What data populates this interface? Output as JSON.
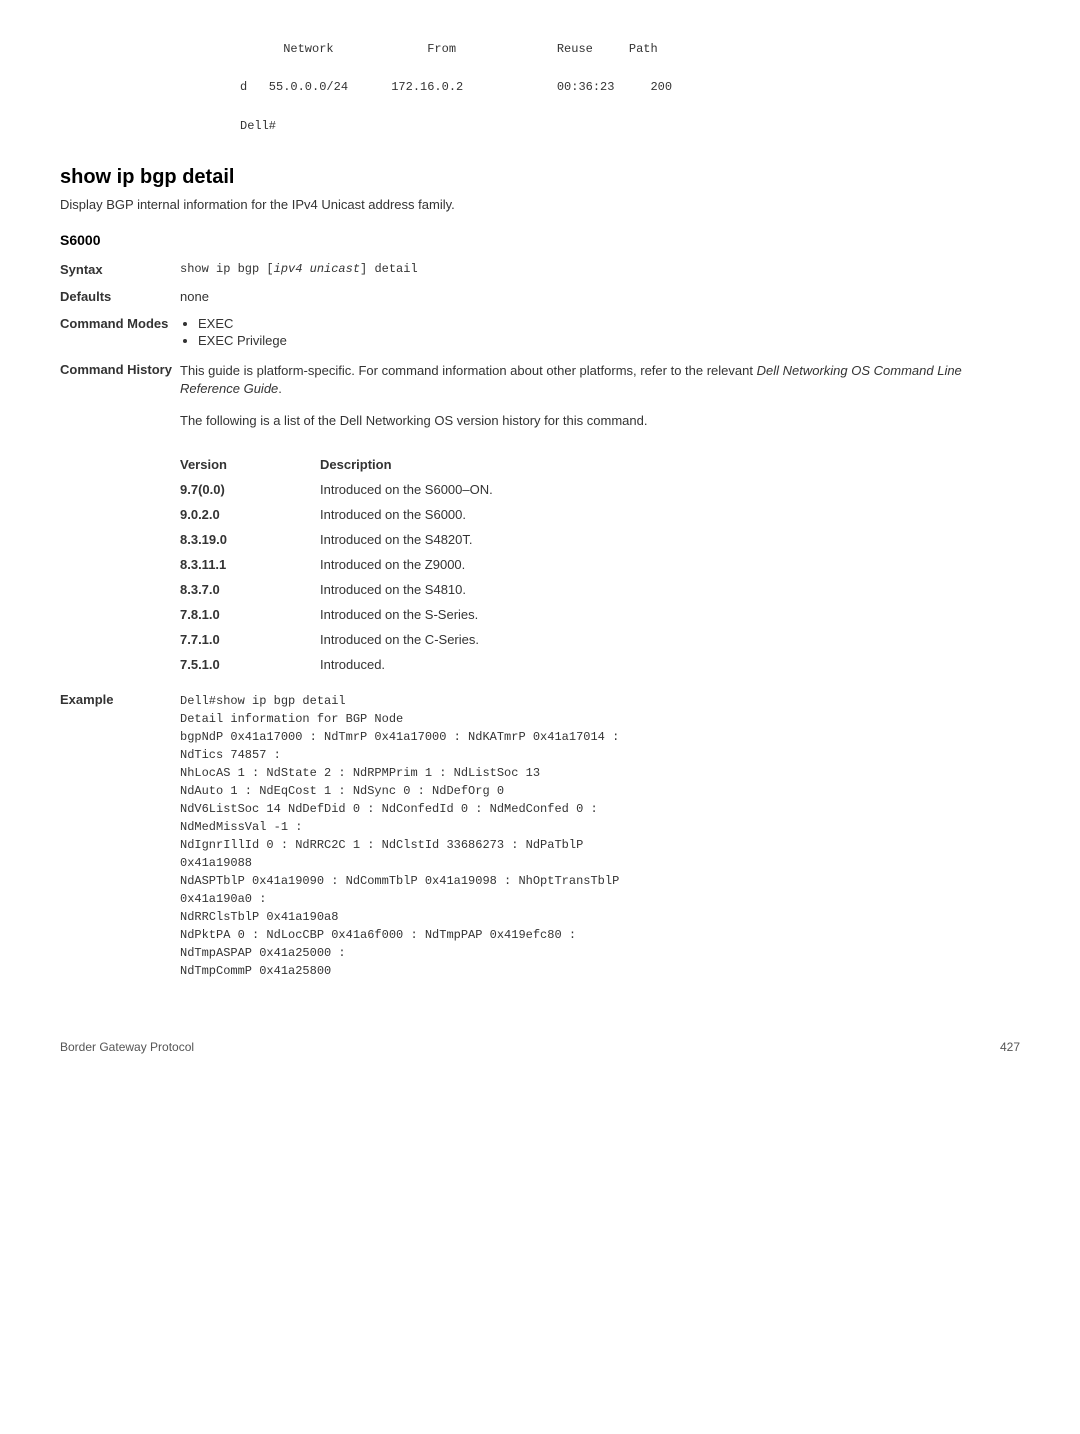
{
  "topCode": "      Network             From              Reuse     Path\n\nd   55.0.0.0/24      172.16.0.2             00:36:23     200\n\nDell#",
  "heading": "show ip bgp detail",
  "headingDesc": "Display BGP internal information for the IPv4 Unicast address family.",
  "platform": "S6000",
  "syntaxLabel": "Syntax",
  "syntaxPrefix": "show ip bgp [",
  "syntaxItalic": "ipv4 unicast",
  "syntaxSuffix": "] detail",
  "defaultsLabel": "Defaults",
  "defaultsValue": "none",
  "modesLabel": "Command Modes",
  "modes": [
    "EXEC",
    "EXEC Privilege"
  ],
  "historyLabel": "Command History",
  "historyDesc1a": "This guide is platform-specific. For command information about other platforms, refer to the relevant ",
  "historyDesc1b": "Dell Networking OS Command Line Reference Guide",
  "historyDesc1c": ".",
  "historyDesc2": "The following is a list of the Dell Networking OS version history for this command.",
  "versionHeader1": "Version",
  "versionHeader2": "Description",
  "versions": [
    {
      "v": "9.7(0.0)",
      "d": "Introduced on the S6000–ON."
    },
    {
      "v": "9.0.2.0",
      "d": "Introduced on the S6000."
    },
    {
      "v": "8.3.19.0",
      "d": "Introduced on the S4820T."
    },
    {
      "v": "8.3.11.1",
      "d": "Introduced on the Z9000."
    },
    {
      "v": "8.3.7.0",
      "d": "Introduced on the S4810."
    },
    {
      "v": "7.8.1.0",
      "d": "Introduced on the S-Series."
    },
    {
      "v": "7.7.1.0",
      "d": "Introduced on the C-Series."
    },
    {
      "v": "7.5.1.0",
      "d": "Introduced."
    }
  ],
  "exampleLabel": "Example",
  "exampleCode": "Dell#show ip bgp detail\nDetail information for BGP Node\nbgpNdP 0x41a17000 : NdTmrP 0x41a17000 : NdKATmrP 0x41a17014 : \nNdTics 74857 :\nNhLocAS 1 : NdState 2 : NdRPMPrim 1 : NdListSoc 13\nNdAuto 1 : NdEqCost 1 : NdSync 0 : NdDefOrg 0\nNdV6ListSoc 14 NdDefDid 0 : NdConfedId 0 : NdMedConfed 0 : \nNdMedMissVal -1 :\nNdIgnrIllId 0 : NdRRC2C 1 : NdClstId 33686273 : NdPaTblP \n0x41a19088\nNdASPTblP 0x41a19090 : NdCommTblP 0x41a19098 : NhOptTransTblP \n0x41a190a0 :\nNdRRClsTblP 0x41a190a8\nNdPktPA 0 : NdLocCBP 0x41a6f000 : NdTmpPAP 0x419efc80 : \nNdTmpASPAP 0x41a25000 :\nNdTmpCommP 0x41a25800",
  "footerLeft": "Border Gateway Protocol",
  "footerRight": "427"
}
